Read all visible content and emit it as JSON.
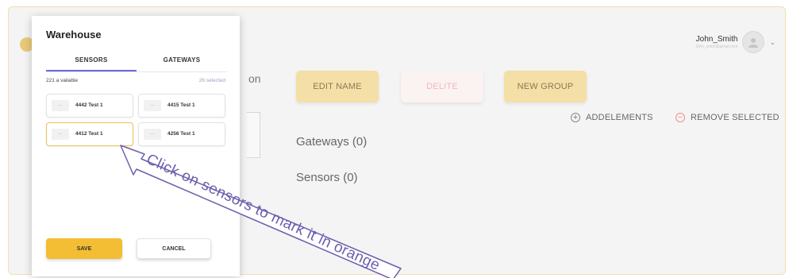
{
  "user": {
    "name": "John_Smith",
    "email": "John_smith@gmail.com"
  },
  "page": {
    "title_fragment": "on",
    "buttons": {
      "edit_name": "EDIT NAME",
      "delete": "DELITE",
      "new_group": "NEW GROUP"
    },
    "actions": {
      "add_elements": "ADDELEMENTS",
      "remove_selected": "REMOVE SELECTED",
      "add_symbol": "+",
      "remove_symbol": "−"
    },
    "sections": {
      "gateways": "Gateways (0)",
      "sensors": "Sensors (0)"
    }
  },
  "modal": {
    "title": "Warehouse",
    "tabs": [
      "SENSORS",
      "GATEWAYS"
    ],
    "active_tab": "SENSORS",
    "available_text": "221 a vailable",
    "selected_text": "26 selected",
    "sensors": [
      {
        "label": "4442 Test 1",
        "selected": false
      },
      {
        "label": "4415 Test 1",
        "selected": false
      },
      {
        "label": "4412 Test 1",
        "selected": true
      },
      {
        "label": "4256 Test 1",
        "selected": false
      }
    ],
    "save_label": "SAVE",
    "cancel_label": "CANCEL"
  },
  "callout": {
    "text": "Click on sensors to mark it in orange"
  },
  "colors": {
    "accent_yellow": "#f3bd34",
    "button_yellow": "#f4dfa6",
    "delete_pink": "#f3b8b8",
    "tab_underline": "#6a6adb",
    "selected_border": "#e9c25a",
    "callout_purple": "#6b5fae",
    "remove_red": "#f08c8c"
  },
  "icons": {
    "logo": "logo-icon",
    "avatar": "avatar-icon",
    "caret": "chevron-down-icon",
    "add": "plus-circle-icon",
    "remove": "minus-circle-icon",
    "sensor_thumb": "sensor-thumbnail-icon",
    "callout_arrow": "arrow-icon"
  }
}
